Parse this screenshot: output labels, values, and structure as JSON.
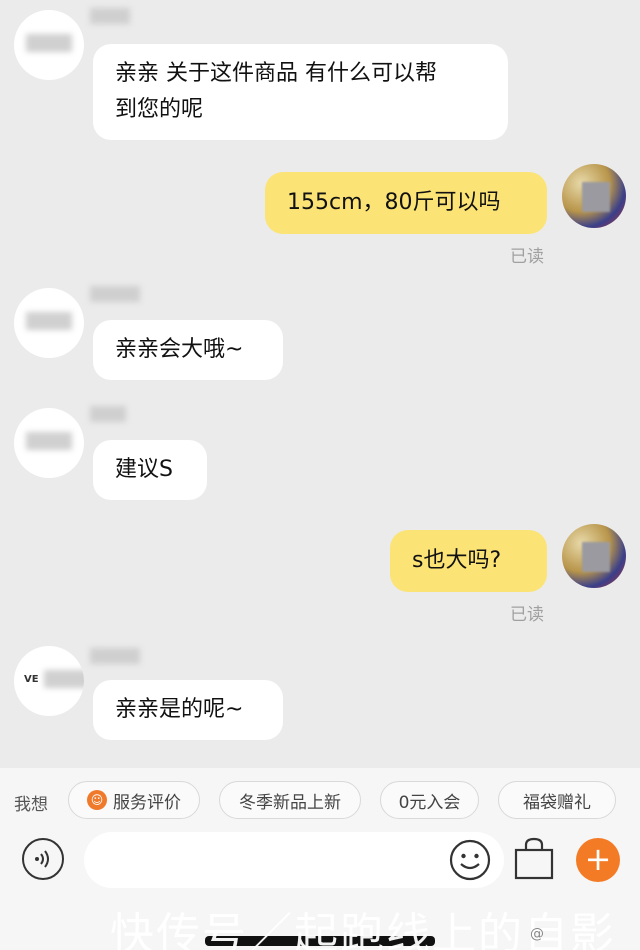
{
  "messages": [
    {
      "side": "in",
      "text_line1": "亲亲 关于这件商品 有什么可以帮",
      "text_line2": "到您的呢"
    },
    {
      "side": "out",
      "text": "155cm，80斤可以吗",
      "status": "已读"
    },
    {
      "side": "in",
      "text": "亲亲会大哦~"
    },
    {
      "side": "in",
      "text": "建议S"
    },
    {
      "side": "out",
      "text": "s也大吗?",
      "status": "已读"
    },
    {
      "side": "in",
      "text": "亲亲是的呢~",
      "avatar_text": "VE"
    }
  ],
  "quick_replies": {
    "label": "我想",
    "chips": [
      "服务评价",
      "冬季新品上新",
      "0元入会",
      "福袋赠礼"
    ]
  },
  "composer": {
    "voice_icon": "voice-icon",
    "emoji_icon": "emoji-icon",
    "bag_icon": "shopping-bag-icon",
    "plus_icon": "plus-icon",
    "plus_glyph": "+"
  },
  "watermark": {
    "text": "快传号／起跑线上的自影",
    "small": "@"
  },
  "colors": {
    "bubble_out": "#fbe376",
    "bubble_in": "#ffffff",
    "accent": "#f37b26",
    "background": "#ebebeb"
  }
}
